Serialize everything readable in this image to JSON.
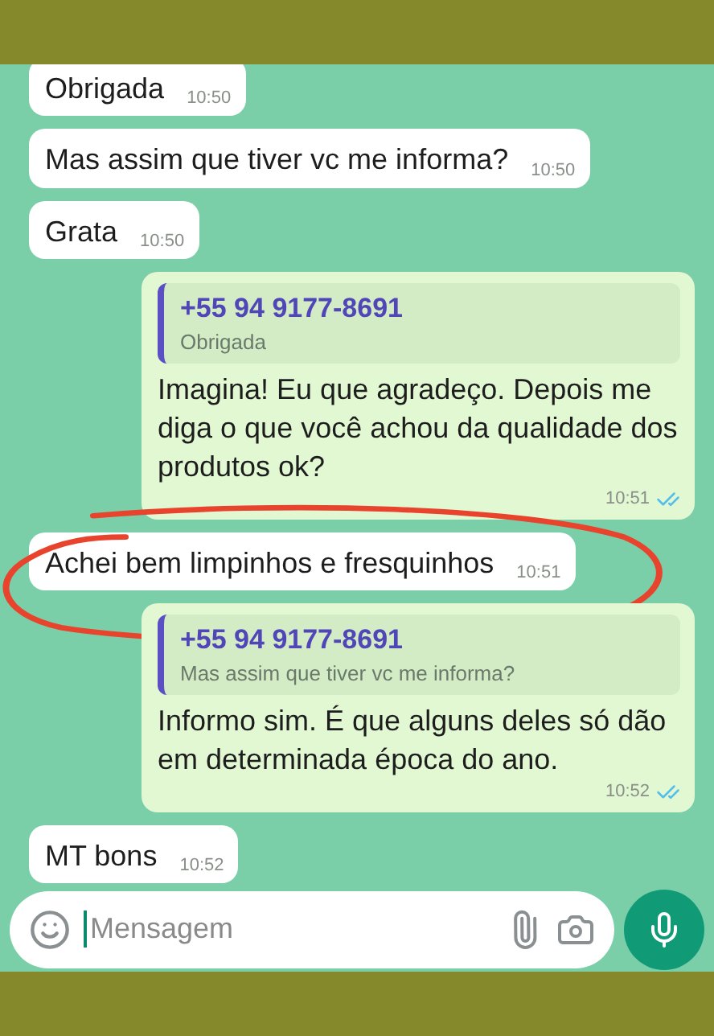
{
  "messages": [
    {
      "kind": "in",
      "text": "Obrigada",
      "time": "10:50",
      "circled": false
    },
    {
      "kind": "in",
      "text": "Mas assim que tiver vc me informa?",
      "time": "10:50",
      "circled": false
    },
    {
      "kind": "in",
      "text": "Grata",
      "time": "10:50",
      "circled": false
    },
    {
      "kind": "out",
      "quote": {
        "author": "+55 94 9177-8691",
        "text": "Obrigada"
      },
      "text": "Imagina!  Eu que agradeço. Depois me diga o que você achou da qualidade dos produtos ok?",
      "time": "10:51",
      "read": true,
      "circled": false
    },
    {
      "kind": "in",
      "text": "Achei bem limpinhos e fresquinhos",
      "time": "10:51",
      "circled": true
    },
    {
      "kind": "out",
      "quote": {
        "author": "+55 94 9177-8691",
        "text": "Mas assim que tiver vc me informa?"
      },
      "text": "Informo sim. É que alguns deles só dão em determinada época do ano.",
      "time": "10:52",
      "read": true,
      "circled": false
    },
    {
      "kind": "in",
      "text": "MT bons",
      "time": "10:52",
      "circled": false
    }
  ],
  "composer": {
    "placeholder": "Mensagem"
  }
}
